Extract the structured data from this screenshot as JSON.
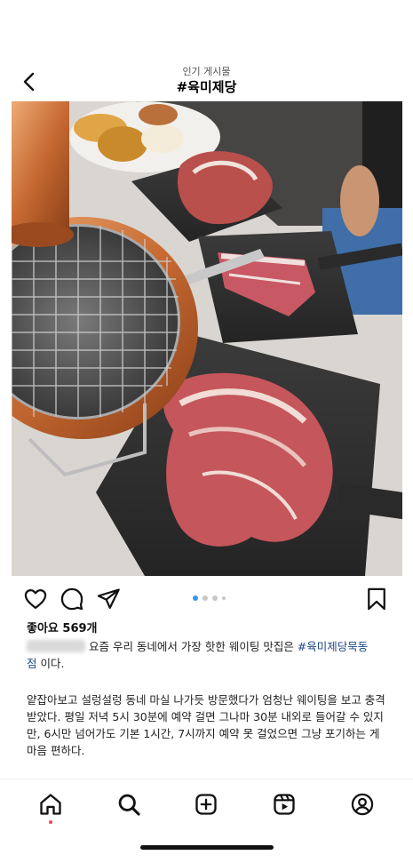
{
  "header": {
    "subtitle": "인기 게시물",
    "title": "#육미제당",
    "icons": {
      "back": "chevron-left-icon"
    }
  },
  "post": {
    "image_description_icon": "grilled-pork-photo",
    "carousel": {
      "current": 1,
      "total": 4
    },
    "actions": {
      "like": "heart-icon",
      "comment": "comment-icon",
      "share": "send-icon",
      "save": "bookmark-icon"
    },
    "likes_text": "좋아요 569개",
    "caption": {
      "line1_text": " 요즘 우리 동네에서 가장 핫한 웨이팅 맛집은 ",
      "hashtag": "#육미제당묵동",
      "hashtag_tail": "점",
      "line1_end": " 이다.",
      "paragraph2": "얕잡아보고 설렁설렁 동네 마실 나가듯 방문했다가 엄청난 웨이팅을 보고 충격 받았다. 평일 저녁 5시 30분에 예약 걸면 그나마 30분 내외로 들어갈 수 있지만, 6시만 넘어가도 기본 1시간, 7시까지 예약 못 걸었으면 그냥 포기하는 게 마음 편하다."
    }
  },
  "tabbar": {
    "items": [
      "home-icon",
      "search-icon",
      "create-icon",
      "reels-icon",
      "profile-icon"
    ],
    "active": "home"
  },
  "colors": {
    "accent": "#3897f0",
    "hashtag": "#1f4a8c",
    "notification": "#ed4956"
  }
}
